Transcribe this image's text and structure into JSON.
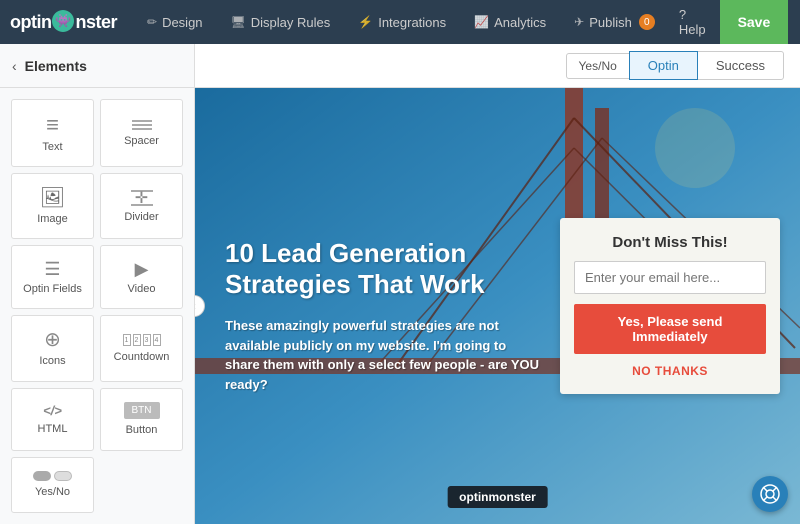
{
  "logo": {
    "text_left": "optin",
    "text_right": "nster"
  },
  "topnav": {
    "items": [
      {
        "id": "design",
        "label": "Design",
        "icon": "✏"
      },
      {
        "id": "display-rules",
        "label": "Display Rules",
        "icon": "🖥"
      },
      {
        "id": "integrations",
        "label": "Integrations",
        "icon": "⚡"
      },
      {
        "id": "analytics",
        "label": "Analytics",
        "icon": "📈"
      },
      {
        "id": "publish",
        "label": "Publish",
        "icon": "✈",
        "badge": "0"
      }
    ],
    "help_label": "? Help",
    "save_label": "Save",
    "close_label": "✕"
  },
  "sidebar": {
    "back_icon": "‹",
    "title": "Elements",
    "elements": [
      {
        "id": "text",
        "label": "Text",
        "icon_type": "lines"
      },
      {
        "id": "spacer",
        "label": "Spacer",
        "icon_type": "spacer"
      },
      {
        "id": "image",
        "label": "Image",
        "icon_type": "image"
      },
      {
        "id": "divider",
        "label": "Divider",
        "icon_type": "divider"
      },
      {
        "id": "optin-fields",
        "label": "Optin Fields",
        "icon_type": "optin"
      },
      {
        "id": "video",
        "label": "Video",
        "icon_type": "video"
      },
      {
        "id": "icons",
        "label": "Icons",
        "icon_type": "icons"
      },
      {
        "id": "countdown",
        "label": "Countdown",
        "icon_type": "countdown"
      },
      {
        "id": "html",
        "label": "HTML",
        "icon_type": "html"
      },
      {
        "id": "button",
        "label": "Button",
        "icon_type": "button"
      },
      {
        "id": "yesno",
        "label": "Yes/No",
        "icon_type": "yesno"
      }
    ]
  },
  "tabs": {
    "yesno_label": "Yes/No",
    "optin_label": "Optin",
    "success_label": "Success",
    "active": "Optin"
  },
  "canvas": {
    "headline": "10 Lead Generation Strategies That Work",
    "subtext": "These amazingly powerful strategies are not available publicly on my website. I'm going to share them with only a select few people - are YOU ready?",
    "optin_box": {
      "title": "Don't Miss This!",
      "email_placeholder": "Enter your email here...",
      "cta_label": "Yes, Please send Immediately",
      "decline_label": "NO THANKS"
    },
    "brand_label": "optinmonster",
    "help_icon": "⊕"
  },
  "colors": {
    "nav_bg": "#2c3e50",
    "save_btn": "#5cb85c",
    "cta_btn": "#e74c3c",
    "decline_text": "#e74c3c",
    "active_tab": "#2980b9",
    "publish_badge": "#e67e22"
  }
}
